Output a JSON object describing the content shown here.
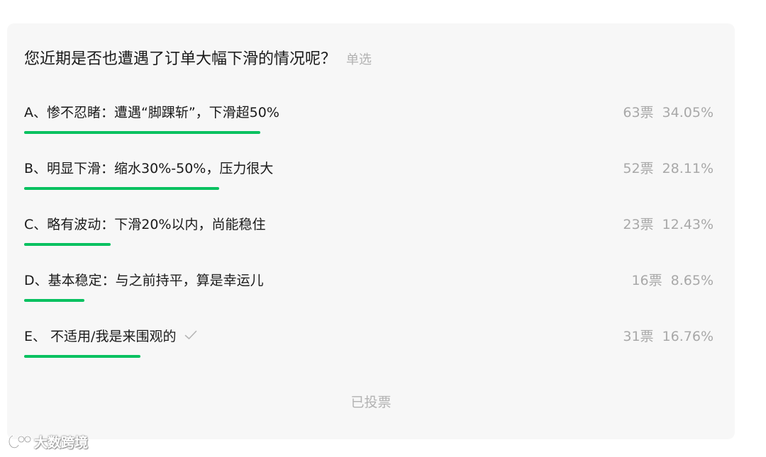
{
  "poll": {
    "question": "您近期是否也遭遇了订单大幅下滑的情况呢？",
    "type_label": "单选",
    "voted_label": "已投票",
    "accent_color": "#07c160",
    "options": [
      {
        "label": "A、惨不忍睹：遭遇“脚踝斩”，下滑超50%",
        "votes": "63票",
        "percent": "34.05%",
        "fraction": 0.3405,
        "selected": false
      },
      {
        "label": "B、明显下滑：缩水30%-50%，压力很大",
        "votes": "52票",
        "percent": "28.11%",
        "fraction": 0.2811,
        "selected": false
      },
      {
        "label": "C、略有波动：下滑20%以内，尚能稳住",
        "votes": "23票",
        "percent": "12.43%",
        "fraction": 0.1243,
        "selected": false
      },
      {
        "label": "D、基本稳定：与之前持平，算是幸运儿",
        "votes": "16票",
        "percent": "8.65%",
        "fraction": 0.0865,
        "selected": false
      },
      {
        "label": "E、 不适用/我是来围观的",
        "votes": "31票",
        "percent": "16.76%",
        "fraction": 0.1676,
        "selected": true,
        "icon": "checkmark-icon"
      }
    ]
  },
  "watermark": {
    "text": "大数跨境",
    "icon": "brand-logo-icon"
  }
}
